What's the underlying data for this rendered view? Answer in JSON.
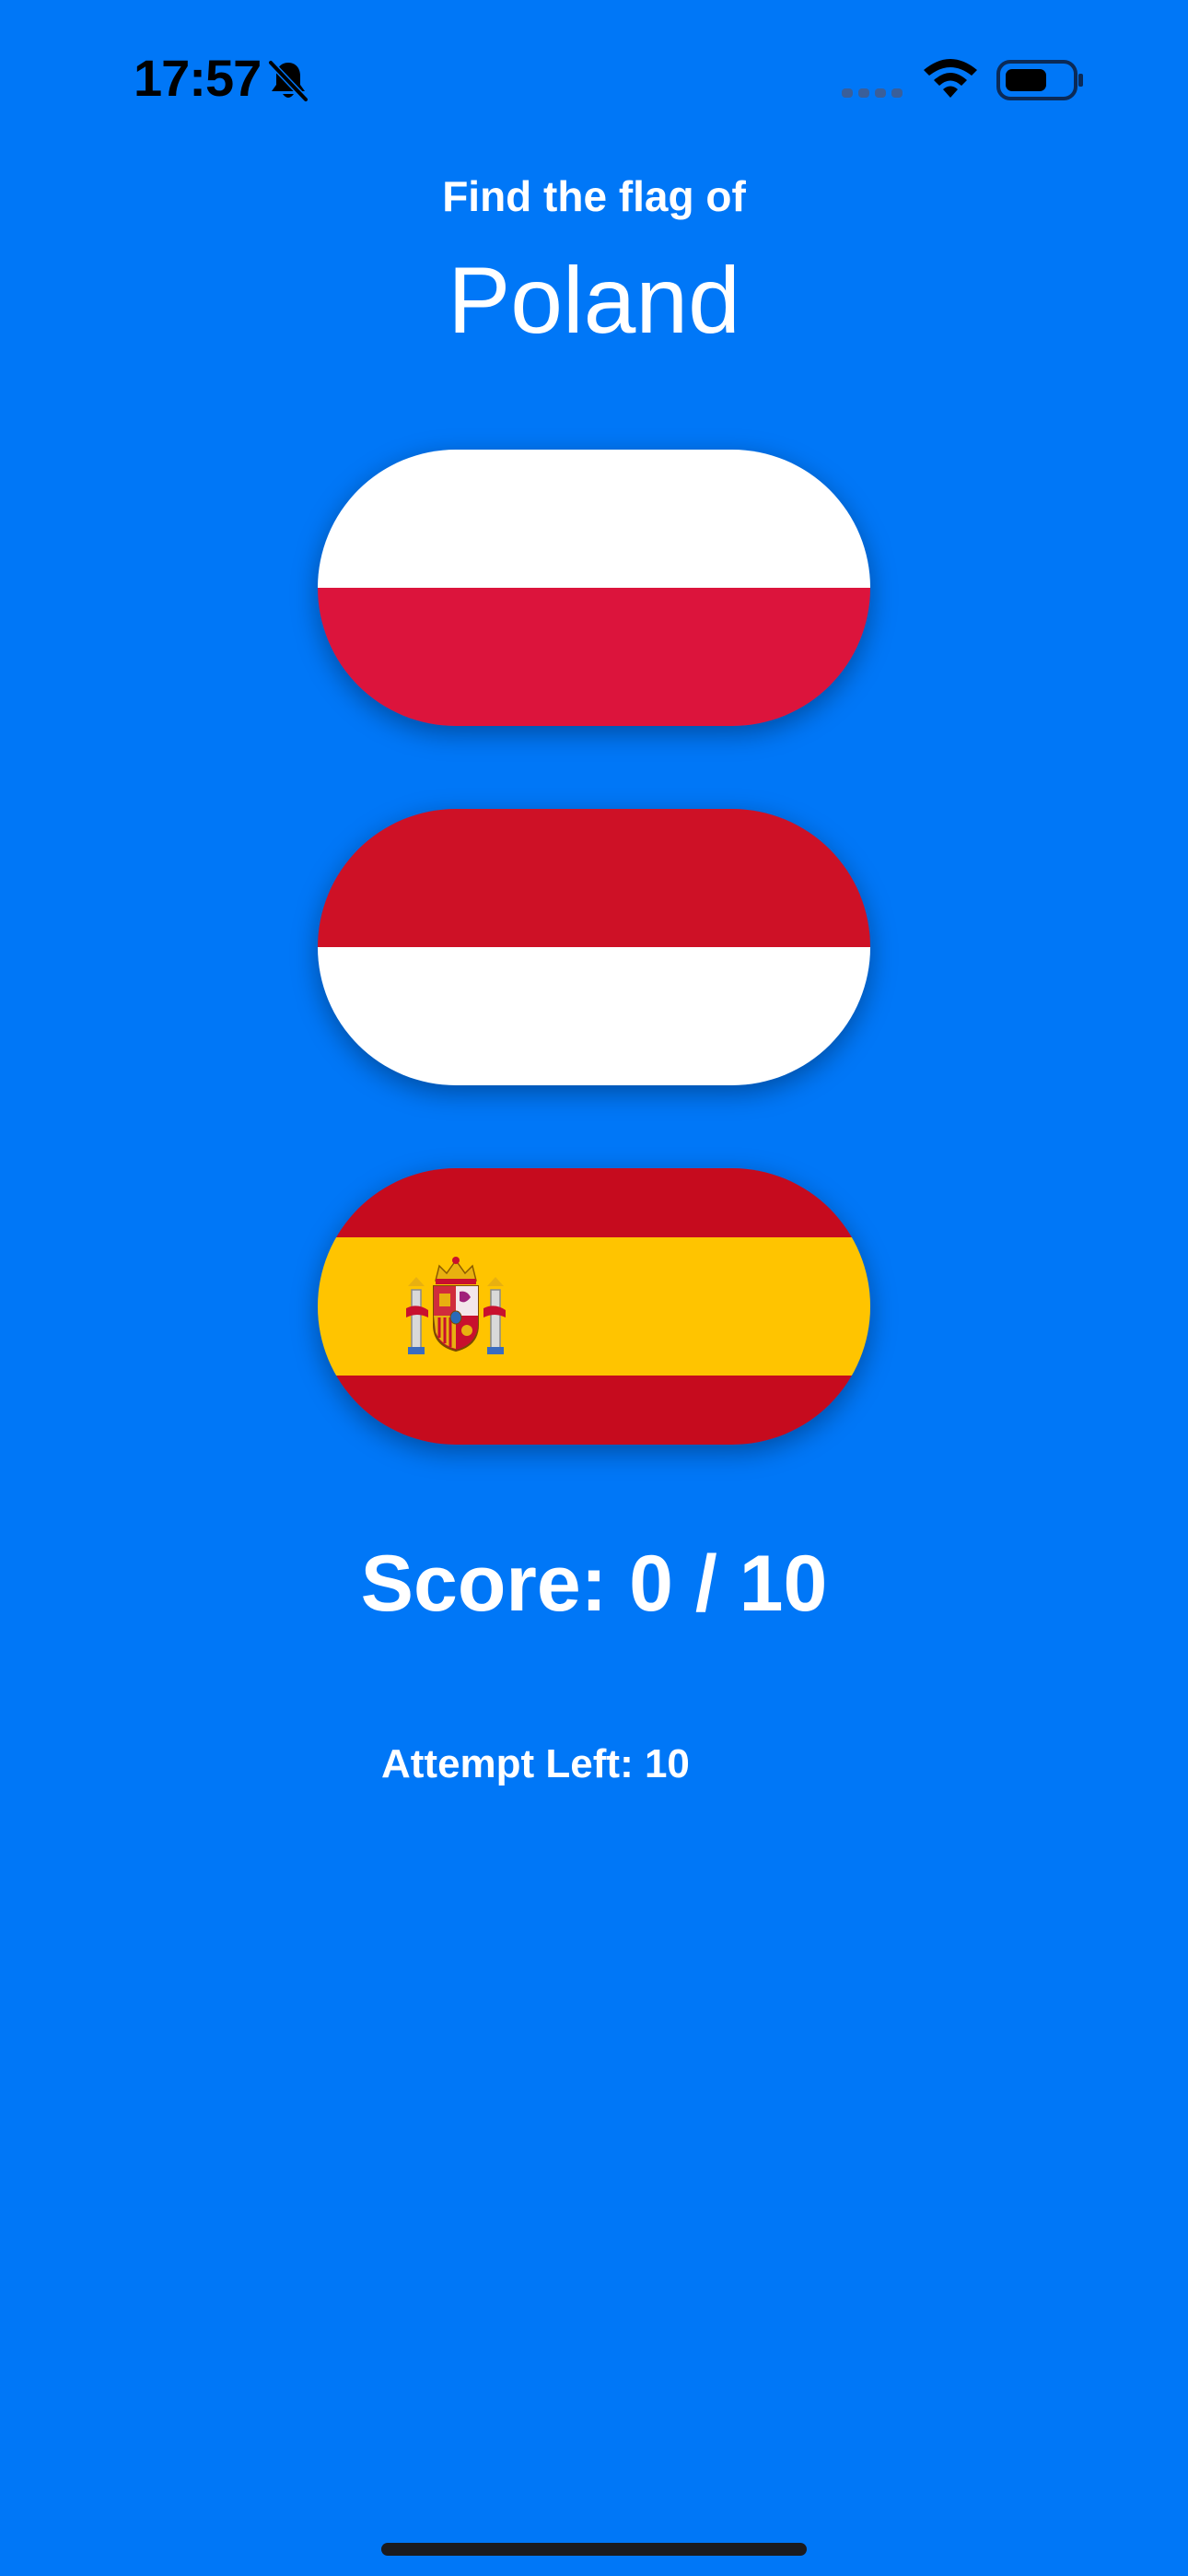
{
  "status_bar": {
    "time": "17:57",
    "icons": [
      "bell-slash-icon",
      "cellular-signal-icon",
      "wifi-icon",
      "battery-icon"
    ]
  },
  "quiz": {
    "prompt": "Find the flag of",
    "country": "Poland"
  },
  "flags": [
    {
      "country_name": "Poland",
      "stripes": [
        "#FFFFFF",
        "#DC143C"
      ]
    },
    {
      "country_name": "Indonesia",
      "stripes": [
        "#CE1126",
        "#FFFFFF"
      ]
    },
    {
      "country_name": "Spain",
      "stripes": [
        "#C60B1E",
        "#FFC400",
        "#C60B1E"
      ]
    }
  ],
  "score": {
    "label": "Score: 0 / 10"
  },
  "attempts": {
    "label": "Attempt Left: 10"
  },
  "colors": {
    "background": "#0077F7",
    "text": "#FFFFFF"
  }
}
